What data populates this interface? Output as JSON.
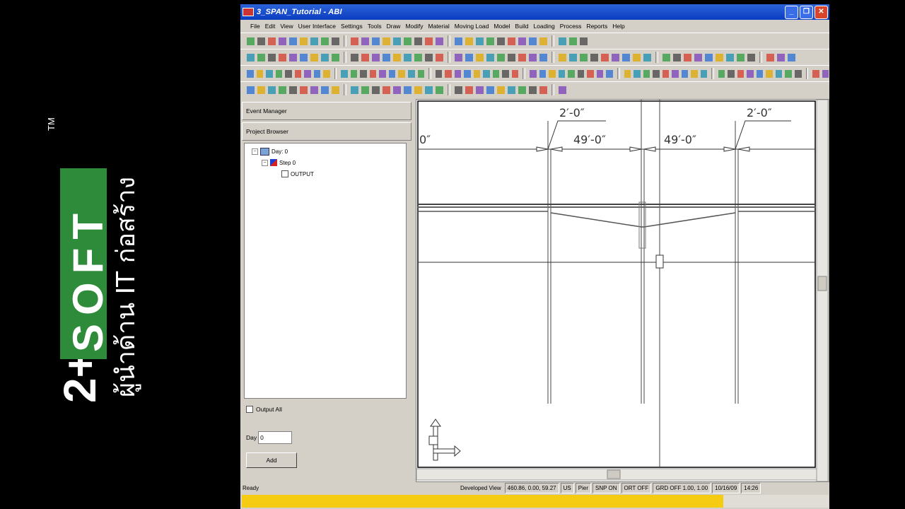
{
  "brand": {
    "prefix": "2+",
    "word": "SOFT",
    "tm": "TM",
    "tagline": "ผู้นำด้าน IT ก่อสร้าง"
  },
  "window": {
    "title": "3_SPAN_Tutorial - ABI",
    "controls": [
      "_",
      "❐",
      "✕"
    ]
  },
  "menu": [
    "File",
    "Edit",
    "View",
    "User Interface",
    "Settings",
    "Tools",
    "Draw",
    "Modify",
    "Material",
    "Moving Load",
    "Model",
    "Build",
    "Loading",
    "Process",
    "Reports",
    "Help"
  ],
  "panels": {
    "event_manager": "Event Manager",
    "project_browser": "Project Browser"
  },
  "tree": {
    "day": "Day: 0",
    "step": "Step 0",
    "output": "OUTPUT"
  },
  "controls": {
    "output_all": "Output All",
    "day_label": "Day",
    "day_value": "0",
    "add": "Add"
  },
  "drawing": {
    "dim_top_left": "2′-0″",
    "dim_top_right": "2′-0″",
    "dim_span_left": "49′-0″",
    "dim_span_right": "49′-0″",
    "dim_edge": "0″"
  },
  "status": {
    "ready": "Ready",
    "view": "Developed View",
    "coords": "460.86, 0.00, 59.27",
    "units": "US",
    "mode": "Pier",
    "snap": "SNP ON",
    "ortho": "ORT OFF",
    "grid": "GRD OFF 1.00, 1.00",
    "date": "10/16/09",
    "time": "14:26"
  },
  "progress": 0.82,
  "colors": {
    "brand_green": "#2e8b3a",
    "title_blue": "#0a3cc0",
    "progress_yellow": "#f5cc12"
  }
}
